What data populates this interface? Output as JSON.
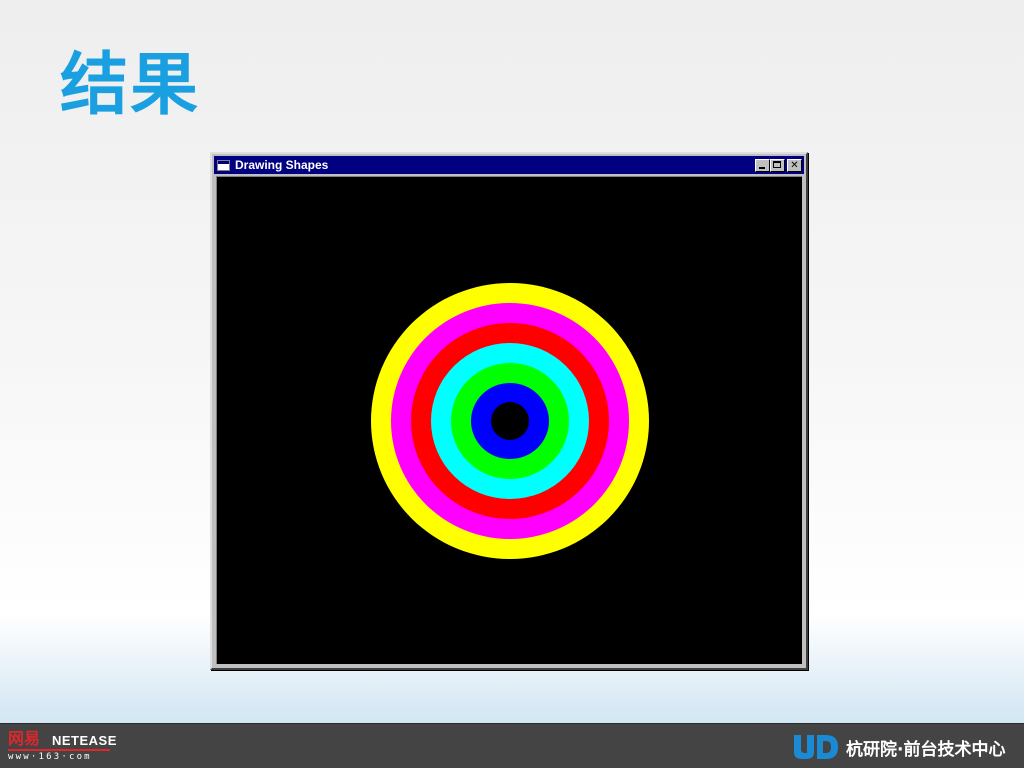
{
  "slide": {
    "title": "结果",
    "title_color": "#1aa0e0"
  },
  "window": {
    "title": "Drawing Shapes",
    "controls": {
      "minimize_icon": "minimize-icon",
      "maximize_icon": "maximize-icon",
      "close_glyph": "✕"
    },
    "canvas": {
      "background": "#000000",
      "rings": [
        {
          "color": "#ffff00"
        },
        {
          "color": "#ff00ff"
        },
        {
          "color": "#ff0000"
        },
        {
          "color": "#00ffff"
        },
        {
          "color": "#00ff00"
        },
        {
          "color": "#0000ff"
        },
        {
          "color": "#000000"
        }
      ]
    }
  },
  "footer": {
    "netease_cn": "网易",
    "netease_en": "NETEASE",
    "netease_url": "www·163·com",
    "dept": "杭研院·前台技术中心",
    "logo_color": "#1a8ad4"
  }
}
